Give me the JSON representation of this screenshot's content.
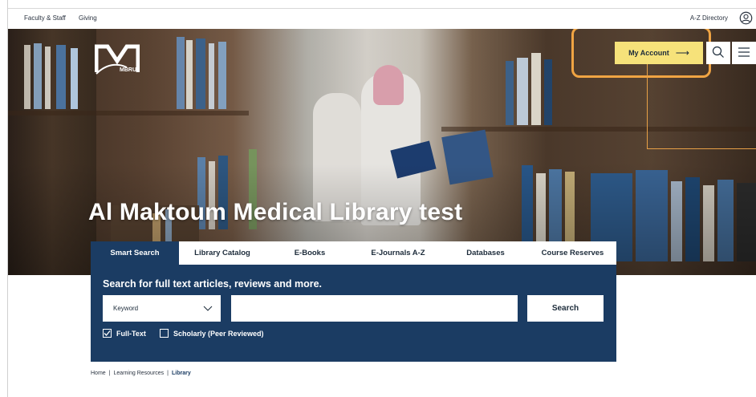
{
  "utility": {
    "faculty": "Faculty & Staff",
    "giving": "Giving",
    "az_directory": "A-Z Directory",
    "user_icon": "user-circle-icon"
  },
  "hero": {
    "logo_text": "MBRU",
    "account_label": "My Account",
    "account_arrow": "⟶",
    "title": "Al Maktoum Medical Library test",
    "accent_color": "#f6e27a",
    "highlight_color": "#f0a443"
  },
  "search": {
    "tabs": [
      {
        "label": "Smart Search",
        "active": true
      },
      {
        "label": "Library Catalog",
        "active": false
      },
      {
        "label": "E-Books",
        "active": false
      },
      {
        "label": "E-Journals A-Z",
        "active": false
      },
      {
        "label": "Databases",
        "active": false
      },
      {
        "label": "Course Reserves",
        "active": false
      }
    ],
    "heading": "Search for full text articles, reviews and more.",
    "field_select": "Keyword",
    "query_value": "",
    "submit_label": "Search",
    "options": [
      {
        "label": "Full-Text",
        "checked": true
      },
      {
        "label": "Scholarly (Peer Reviewed)",
        "checked": false
      }
    ],
    "panel_color": "#1b3c63"
  },
  "breadcrumb": {
    "items": [
      "Home",
      "Learning Resources",
      "Library"
    ],
    "separator": "|"
  }
}
